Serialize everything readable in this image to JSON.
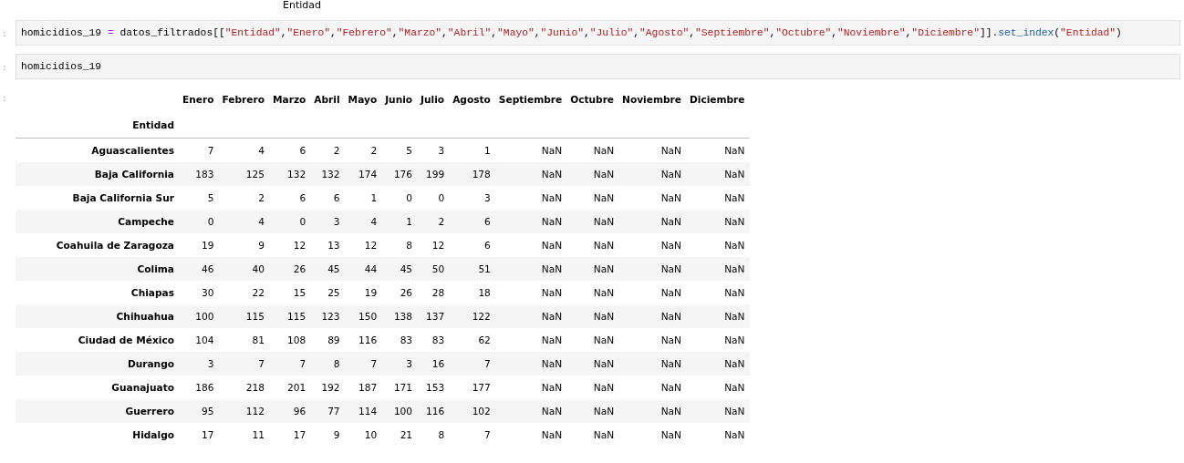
{
  "top_label": "Entidad",
  "cells": [
    {
      "prompt": ":",
      "tokens": [
        {
          "kind": "name",
          "text": "homicidios_19 "
        },
        {
          "kind": "operator",
          "text": "="
        },
        {
          "kind": "name",
          "text": " datos_filtrados[["
        },
        {
          "kind": "string",
          "text": "\"Entidad\""
        },
        {
          "kind": "name",
          "text": ","
        },
        {
          "kind": "string",
          "text": "\"Enero\""
        },
        {
          "kind": "name",
          "text": ","
        },
        {
          "kind": "string",
          "text": "\"Febrero\""
        },
        {
          "kind": "name",
          "text": ","
        },
        {
          "kind": "string",
          "text": "\"Marzo\""
        },
        {
          "kind": "name",
          "text": ","
        },
        {
          "kind": "string",
          "text": "\"Abril\""
        },
        {
          "kind": "name",
          "text": ","
        },
        {
          "kind": "string",
          "text": "\"Mayo\""
        },
        {
          "kind": "name",
          "text": ","
        },
        {
          "kind": "string",
          "text": "\"Junio\""
        },
        {
          "kind": "name",
          "text": ","
        },
        {
          "kind": "string",
          "text": "\"Julio\""
        },
        {
          "kind": "name",
          "text": ","
        },
        {
          "kind": "string",
          "text": "\"Agosto\""
        },
        {
          "kind": "name",
          "text": ","
        },
        {
          "kind": "string",
          "text": "\"Septiembre\""
        },
        {
          "kind": "name",
          "text": ","
        },
        {
          "kind": "string",
          "text": "\"Octubre\""
        },
        {
          "kind": "name",
          "text": ","
        },
        {
          "kind": "string",
          "text": "\"Noviembre\""
        },
        {
          "kind": "name",
          "text": ","
        },
        {
          "kind": "string",
          "text": "\"Diciembre\""
        },
        {
          "kind": "name",
          "text": "]]."
        },
        {
          "kind": "method",
          "text": "set_index"
        },
        {
          "kind": "name",
          "text": "("
        },
        {
          "kind": "string",
          "text": "\"Entidad\""
        },
        {
          "kind": "name",
          "text": ")"
        }
      ]
    },
    {
      "prompt": ":",
      "tokens": [
        {
          "kind": "name",
          "text": "homicidios_19"
        }
      ]
    }
  ],
  "output": {
    "prompt": ":",
    "index_name": "Entidad",
    "columns": [
      "Enero",
      "Febrero",
      "Marzo",
      "Abril",
      "Mayo",
      "Junio",
      "Julio",
      "Agosto",
      "Septiembre",
      "Octubre",
      "Noviembre",
      "Diciembre"
    ],
    "rows": [
      {
        "label": "Aguascalientes",
        "values": [
          "7",
          "4",
          "6",
          "2",
          "2",
          "5",
          "3",
          "1",
          "NaN",
          "NaN",
          "NaN",
          "NaN"
        ]
      },
      {
        "label": "Baja California",
        "values": [
          "183",
          "125",
          "132",
          "132",
          "174",
          "176",
          "199",
          "178",
          "NaN",
          "NaN",
          "NaN",
          "NaN"
        ]
      },
      {
        "label": "Baja California Sur",
        "values": [
          "5",
          "2",
          "6",
          "6",
          "1",
          "0",
          "0",
          "3",
          "NaN",
          "NaN",
          "NaN",
          "NaN"
        ]
      },
      {
        "label": "Campeche",
        "values": [
          "0",
          "4",
          "0",
          "3",
          "4",
          "1",
          "2",
          "6",
          "NaN",
          "NaN",
          "NaN",
          "NaN"
        ]
      },
      {
        "label": "Coahuila de Zaragoza",
        "values": [
          "19",
          "9",
          "12",
          "13",
          "12",
          "8",
          "12",
          "6",
          "NaN",
          "NaN",
          "NaN",
          "NaN"
        ]
      },
      {
        "label": "Colima",
        "values": [
          "46",
          "40",
          "26",
          "45",
          "44",
          "45",
          "50",
          "51",
          "NaN",
          "NaN",
          "NaN",
          "NaN"
        ]
      },
      {
        "label": "Chiapas",
        "values": [
          "30",
          "22",
          "15",
          "25",
          "19",
          "26",
          "28",
          "18",
          "NaN",
          "NaN",
          "NaN",
          "NaN"
        ]
      },
      {
        "label": "Chihuahua",
        "values": [
          "100",
          "115",
          "115",
          "123",
          "150",
          "138",
          "137",
          "122",
          "NaN",
          "NaN",
          "NaN",
          "NaN"
        ]
      },
      {
        "label": "Ciudad de México",
        "values": [
          "104",
          "81",
          "108",
          "89",
          "116",
          "83",
          "83",
          "62",
          "NaN",
          "NaN",
          "NaN",
          "NaN"
        ]
      },
      {
        "label": "Durango",
        "values": [
          "3",
          "7",
          "7",
          "8",
          "7",
          "3",
          "16",
          "7",
          "NaN",
          "NaN",
          "NaN",
          "NaN"
        ]
      },
      {
        "label": "Guanajuato",
        "values": [
          "186",
          "218",
          "201",
          "192",
          "187",
          "171",
          "153",
          "177",
          "NaN",
          "NaN",
          "NaN",
          "NaN"
        ]
      },
      {
        "label": "Guerrero",
        "values": [
          "95",
          "112",
          "96",
          "77",
          "114",
          "100",
          "116",
          "102",
          "NaN",
          "NaN",
          "NaN",
          "NaN"
        ]
      },
      {
        "label": "Hidalgo",
        "values": [
          "17",
          "11",
          "17",
          "9",
          "10",
          "21",
          "8",
          "7",
          "NaN",
          "NaN",
          "NaN",
          "NaN"
        ]
      }
    ]
  }
}
